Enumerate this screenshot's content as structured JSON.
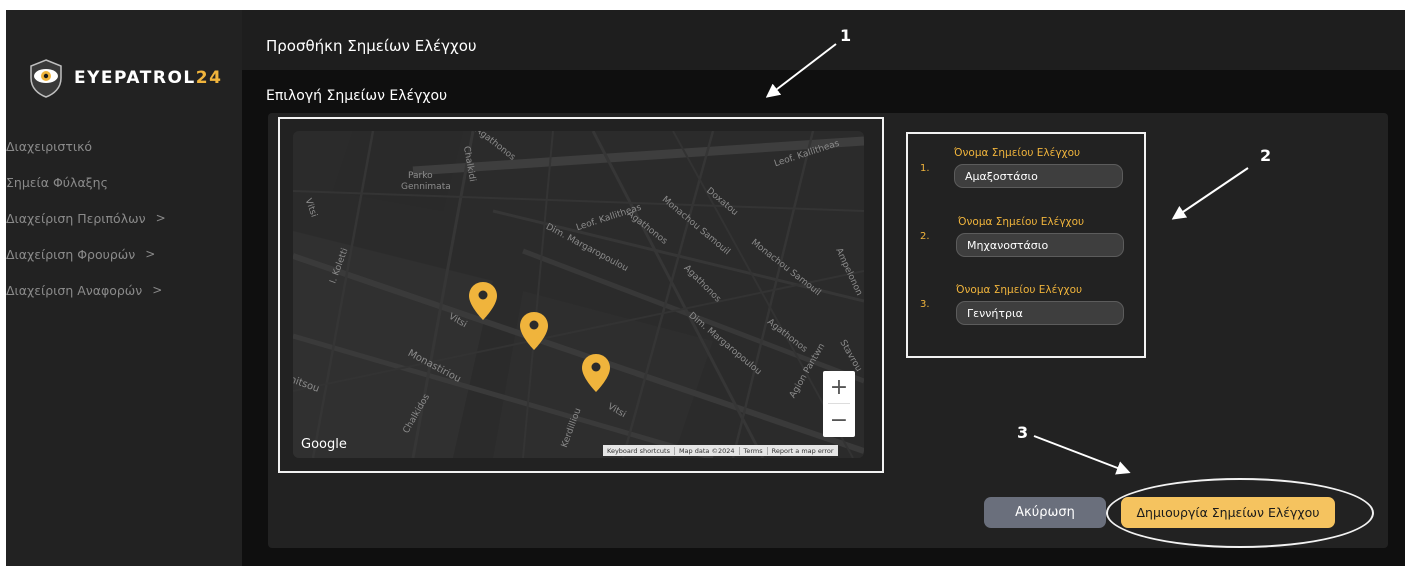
{
  "brand": {
    "name_main": "EYEPATROL",
    "name_accent": "24",
    "accent_color": "#f0b43c"
  },
  "sidebar": {
    "items": [
      {
        "label": "Διαχειριστικό",
        "chevron": ""
      },
      {
        "label": "Σημεία Φύλαξης",
        "chevron": ""
      },
      {
        "label": "Διαχείριση Περιπόλων",
        "chevron": ">"
      },
      {
        "label": "Διαχείριση Φρουρών",
        "chevron": ">"
      },
      {
        "label": "Διαχείριση Αναφορών",
        "chevron": ">"
      }
    ]
  },
  "header": {
    "title": "Προσθήκη Σημείων Ελέγχου"
  },
  "main": {
    "section_title": "Επιλογή Σημείων Ελέγχου"
  },
  "map": {
    "street_labels": [
      "Agathonos",
      "Parko",
      "Gennimata",
      "Chalkidi",
      "Leof. Kallitheas",
      "Leof. Kallitheas",
      "Agathonos",
      "Monachou Samouil",
      "Doxatou",
      "Dim. Margaropoulou",
      "Agathonos",
      "Monachou Samouil",
      "Ampelonon",
      "I. Koletti",
      "Vitsi",
      "Vitsi",
      "Monastiriou",
      "nitsou",
      "Chalkidos",
      "Dim. Margaropoulou",
      "Agathonos",
      "Agion Pantwn",
      "Vitsi",
      "Kerdilliou",
      "Stavrou",
      "Spetson",
      "Pierio"
    ],
    "pin_color": "#f0b43c",
    "zoom_in": "+",
    "zoom_out": "−",
    "provider": "Google",
    "attribution": [
      "Keyboard shortcuts",
      "Map data ©2024",
      "Terms",
      "Report a map error"
    ]
  },
  "checkpoints": [
    {
      "number": "1.",
      "label": "Όνομα Σημείου Ελέγχου",
      "value": "Αμαξοστάσιο"
    },
    {
      "number": "2.",
      "label": "Όνομα Σημείου Ελέγχου",
      "value": "Μηχανοστάσιο"
    },
    {
      "number": "3.",
      "label": "Όνομα Σημείου Ελέγχου",
      "value": "Γεννήτρια"
    }
  ],
  "annotations": [
    "1",
    "2",
    "3"
  ],
  "actions": {
    "cancel_label": "Ακύρωση",
    "create_label": "Δημιουργία Σημείων Ελέγχου",
    "cancel_color": "#6a6f7c",
    "create_color": "#f5c35f"
  }
}
